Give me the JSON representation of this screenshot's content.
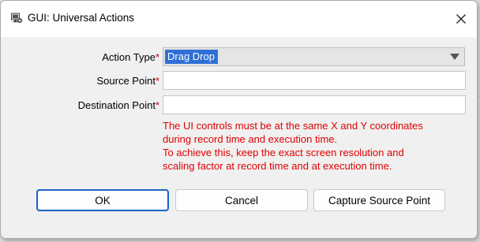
{
  "window": {
    "title": "GUI: Universal Actions",
    "close_glyph": "✕",
    "icon": "monitor-gear-icon"
  },
  "form": {
    "action_type": {
      "label": "Action Type",
      "required_mark": "*",
      "value": "Drag Drop"
    },
    "source_point": {
      "label": "Source Point",
      "required_mark": "*",
      "value": ""
    },
    "destination_point": {
      "label": "Destination Point",
      "required_mark": "*",
      "value": ""
    }
  },
  "warning": {
    "lines": [
      "The UI controls must be at the same X and Y coordinates",
      "during record time and execution time.",
      "To achieve this, keep the exact screen resolution and",
      "scaling factor at record time and at execution time."
    ],
    "color": "#e00000"
  },
  "buttons": {
    "ok": "OK",
    "cancel": "Cancel",
    "capture": "Capture Source Point"
  },
  "colors": {
    "accent": "#1a62c4",
    "selection": "#2f6fd6",
    "required": "#d40000"
  }
}
